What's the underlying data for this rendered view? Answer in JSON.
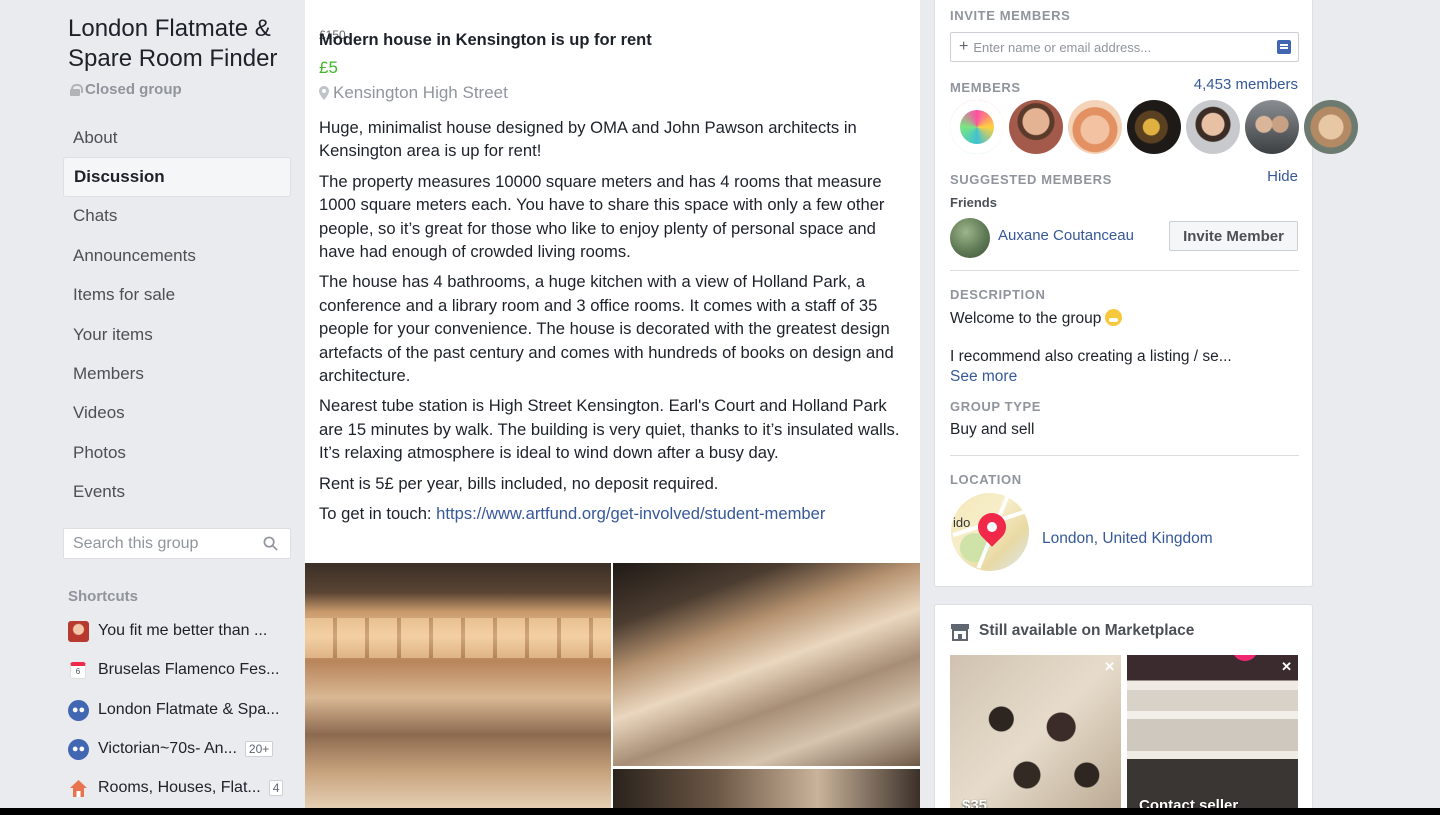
{
  "group": {
    "title": "London Flatmate & Spare Room Finder",
    "privacy": "Closed group"
  },
  "nav": [
    {
      "label": "About"
    },
    {
      "label": "Discussion",
      "active": true
    },
    {
      "label": "Chats"
    },
    {
      "label": "Announcements"
    },
    {
      "label": "Items for sale"
    },
    {
      "label": "Your items"
    },
    {
      "label": "Members"
    },
    {
      "label": "Videos"
    },
    {
      "label": "Photos"
    },
    {
      "label": "Events"
    }
  ],
  "search": {
    "placeholder": "Search this group"
  },
  "shortcuts": {
    "heading": "Shortcuts",
    "items": [
      {
        "label": "You fit me better than ...",
        "icon": "avatar-icon",
        "badge": ""
      },
      {
        "label": "Bruselas Flamenco Fes...",
        "icon": "calendar-icon",
        "badge": ""
      },
      {
        "label": "London Flatmate & Spa...",
        "icon": "group-icon",
        "badge": ""
      },
      {
        "label": "Victorian~70s- An...",
        "icon": "group-icon",
        "badge": "20+"
      },
      {
        "label": "Rooms, Houses, Flat...",
        "icon": "house-icon",
        "badge": "4"
      }
    ]
  },
  "post": {
    "ghost": "£150",
    "title": "Modern house in Kensington is up for rent",
    "price": "£5",
    "location": "Kensington High Street",
    "paragraphs": [
      "Huge, minimalist house designed by OMA and John Pawson architects in Kensington area is up for rent!",
      "The property measures 10000 square meters and has 4 rooms that measure 1000 square meters each. You have to share this space with only a few other people, so it’s great for those who like to enjoy plenty of personal space and have had enough of crowded living rooms.",
      "The house has 4 bathrooms, a huge kitchen with a view of Holland Park, a conference and a library room and 3 office rooms. It comes with a staff of 35 people for your convenience. The house is decorated with the greatest design artefacts of the past century and comes with hundreds of books on design and architecture.",
      "Nearest tube station is High Street Kensington. Earl's Court and Holland Park are 15 minutes by walk. The building is very quiet, thanks to it’s insulated walls. It’s relaxing atmosphere is ideal to wind down after a busy day.",
      "Rent is 5£ per year, bills included, no deposit required."
    ],
    "contact_prefix": "To get in touch: ",
    "contact_link": "https://www.artfund.org/get-involved/student-member"
  },
  "sidebar_right": {
    "invite_heading": "INVITE MEMBERS",
    "invite_placeholder": "Enter name or email address...",
    "members_heading": "MEMBERS",
    "members_count": "4,453 members",
    "suggested_heading": "SUGGESTED MEMBERS",
    "hide_label": "Hide",
    "friends_label": "Friends",
    "suggested_name": "Auxane Coutanceau",
    "invite_button": "Invite Member",
    "description_heading": "DESCRIPTION",
    "description_line1": "Welcome to the group",
    "description_line2": "I recommend also creating a listing / se...",
    "see_more": "See more",
    "group_type_heading": "GROUP TYPE",
    "group_type": "Buy and sell",
    "location_heading": "LOCATION",
    "location_map_text": "ido",
    "location": "London, United Kingdom"
  },
  "marketplace": {
    "title": "Still available on Marketplace",
    "items": [
      {
        "label": "$35"
      },
      {
        "label": "Contact seller"
      }
    ]
  },
  "colors": {
    "link": "#365899",
    "price": "#42b72a",
    "pin": "#f02849",
    "background": "#e9ebee"
  }
}
